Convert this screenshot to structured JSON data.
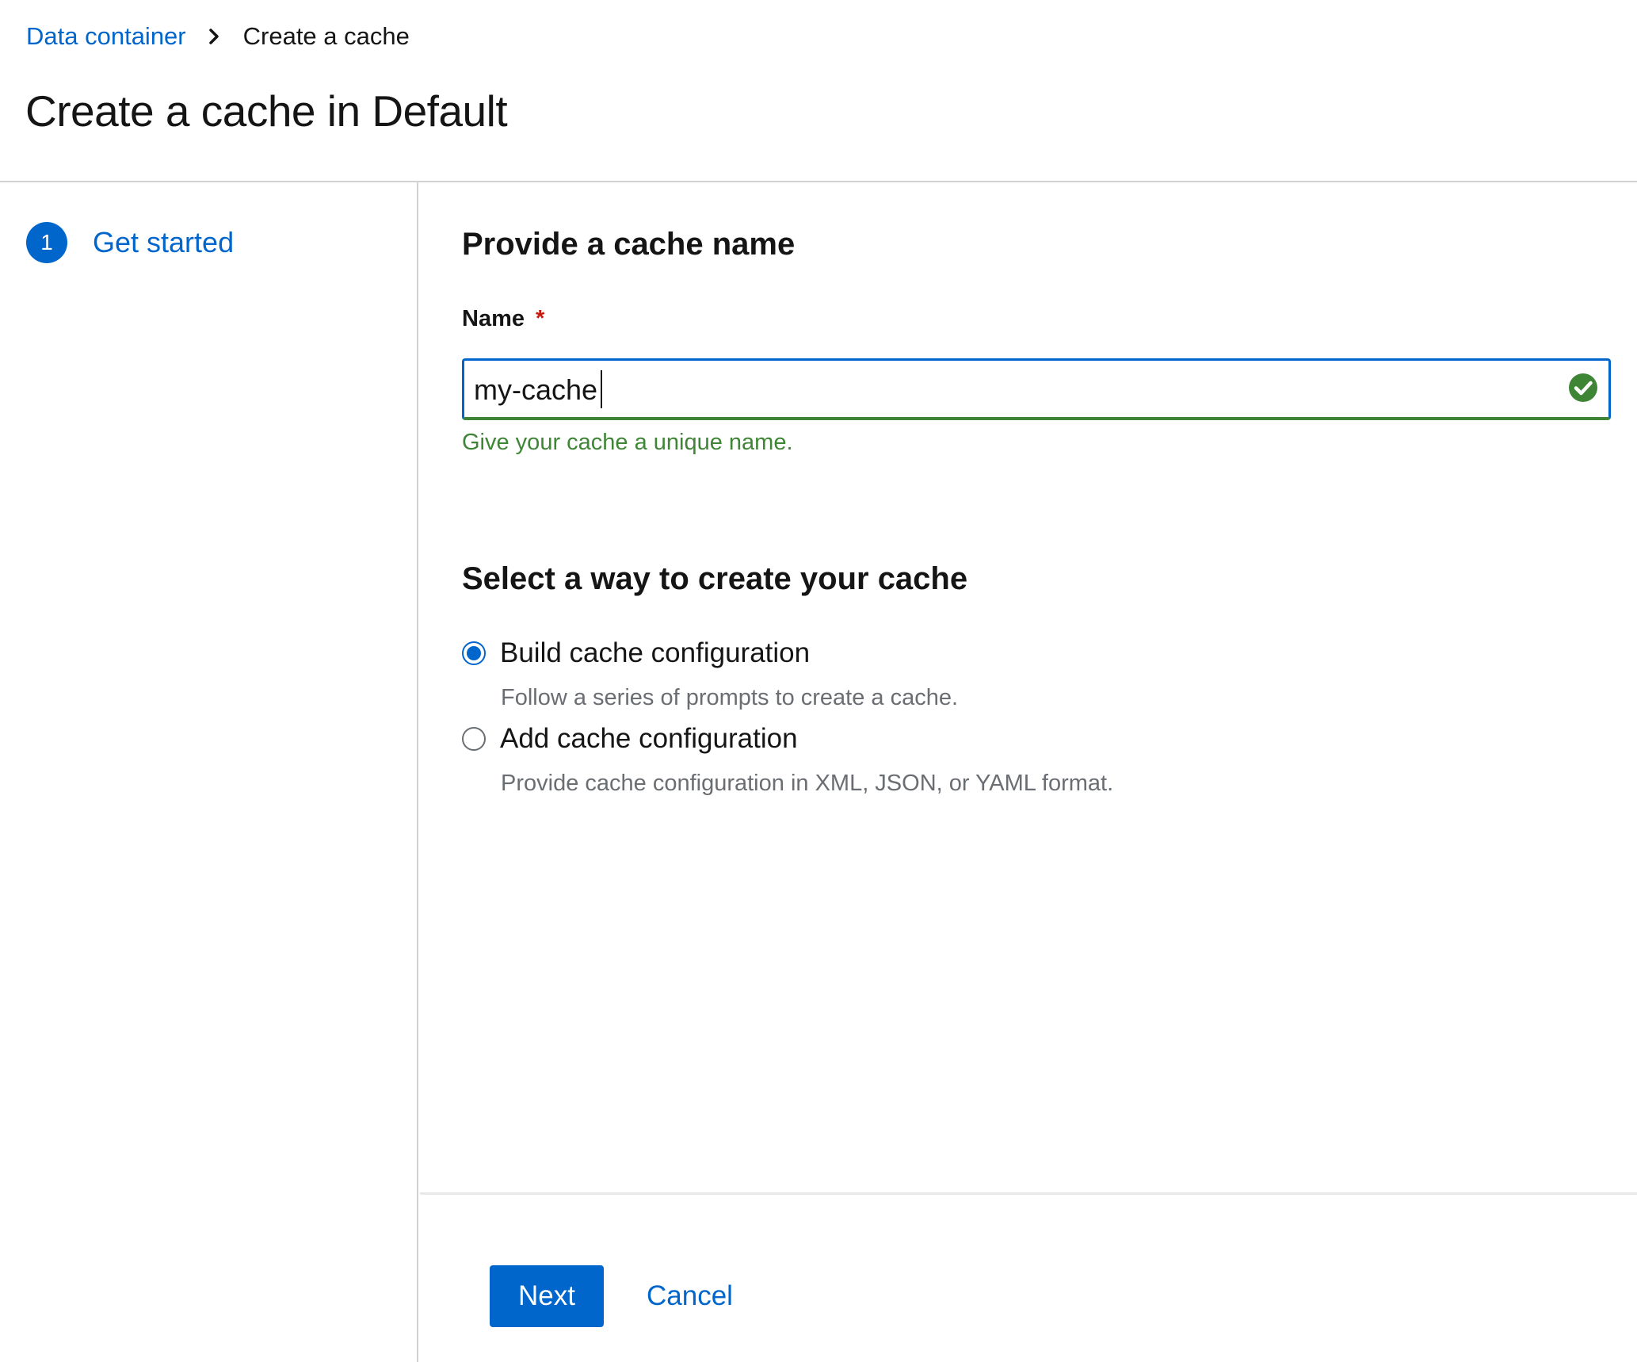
{
  "breadcrumb": {
    "parent": "Data container",
    "current": "Create a cache"
  },
  "page": {
    "title": "Create a cache in Default"
  },
  "wizard_nav": {
    "steps": [
      {
        "number": "1",
        "label": "Get started",
        "active": true
      }
    ]
  },
  "form": {
    "name_section_title": "Provide a cache name",
    "name_label": "Name",
    "required_marker": "*",
    "name_value": "my-cache",
    "name_helper": "Give your cache a unique name.",
    "name_status": "success",
    "method_section_title": "Select a way to create your cache",
    "options": [
      {
        "label": "Build cache configuration",
        "description": "Follow a series of prompts to create a cache.",
        "selected": true
      },
      {
        "label": "Add cache configuration",
        "description": "Provide cache configuration in XML, JSON, or YAML format.",
        "selected": false
      }
    ]
  },
  "footer": {
    "next_label": "Next",
    "cancel_label": "Cancel"
  },
  "colors": {
    "primary": "#0066cc",
    "success": "#3e8635",
    "required": "#c9190b",
    "text": "#151515",
    "muted": "#6a6e73"
  },
  "icons": {
    "breadcrumb_separator": "chevron-right-icon",
    "input_status": "check-circle-icon"
  }
}
